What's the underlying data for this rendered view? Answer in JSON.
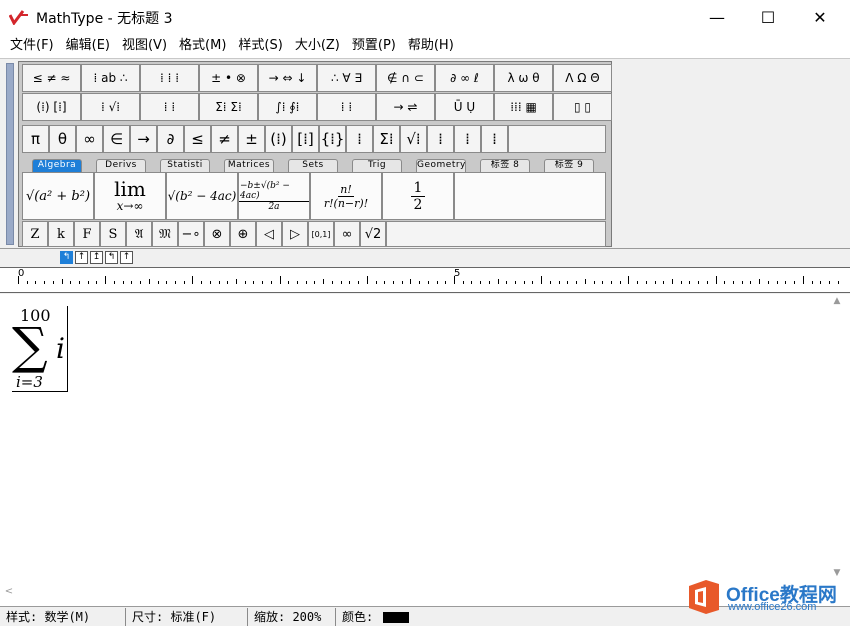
{
  "window": {
    "title": "MathType - 无标题 3",
    "controls": {
      "minimize": "—",
      "maximize": "☐",
      "close": "✕"
    }
  },
  "menu": [
    "文件(F)",
    "编辑(E)",
    "视图(V)",
    "格式(M)",
    "样式(S)",
    "大小(Z)",
    "预置(P)",
    "帮助(H)"
  ],
  "toolbar": {
    "row1": [
      "≤ ≠ ≈",
      "⁞ ab ∴",
      "⁞ ⁞ ⁞",
      "± • ⊗",
      "→ ⇔ ↓",
      "∴ ∀ ∃",
      "∉ ∩ ⊂",
      "∂ ∞ ℓ",
      "λ ω θ",
      "Λ Ω Θ"
    ],
    "row2": [
      "(⁞) [⁞]",
      "⁞ √⁞",
      "⁞ ⁞",
      "Σ⁞ Σ⁞",
      "∫⁞ ∮⁞",
      "⁞ ⁞",
      "→ ⇌",
      "Ū Ụ",
      "⁞⁞⁞ ▦",
      "▯ ▯"
    ],
    "row3": [
      "π",
      "θ",
      "∞",
      "∈",
      "→",
      "∂",
      "≤",
      "≠",
      "±",
      "(⁞)",
      "[⁞]",
      "{⁞}",
      "⁞",
      "Σ⁞",
      "√⁞",
      "⁞",
      "⁞",
      "⁞"
    ],
    "tabs": [
      "Algebra",
      "Derivs",
      "Statisti",
      "Matrices",
      "Sets",
      "Trig",
      "Geometry",
      "标签 8",
      "标签 9"
    ],
    "active_tab": "Algebra",
    "templates": {
      "t1": "√(a² + b²)",
      "t2_top": "lim",
      "t2_bottom": "x→∞",
      "t3": "√(b² − 4ac)",
      "t4_top": "−b±√(b² − 4ac)",
      "t4_bottom": "2a",
      "t5_top": "n!",
      "t5_bottom": "r!(n−r)!",
      "t6_top": "1",
      "t6_bottom": "2"
    },
    "row5": [
      "Z",
      "k",
      "F",
      "S",
      "𝔄",
      "𝔐",
      "−∘",
      "⊗",
      "⊕",
      "◁",
      "▷",
      "[0,1]",
      "∞",
      "√2"
    ]
  },
  "ruler": {
    "tabstops": [
      "↰",
      "↑",
      "↥",
      "↰",
      "↑"
    ],
    "labels": [
      "0",
      "5"
    ]
  },
  "equation": {
    "upper": "100",
    "operator": "∑",
    "body": "i",
    "lower": "i=3"
  },
  "status": {
    "style": "样式: 数学(M)",
    "size": "尺寸: 标准(F)",
    "zoom": "缩放: 200%",
    "color": "颜色:",
    "color_value": "#000000"
  },
  "watermark": {
    "brand": "Office教程网",
    "url": "www.office26.com"
  }
}
